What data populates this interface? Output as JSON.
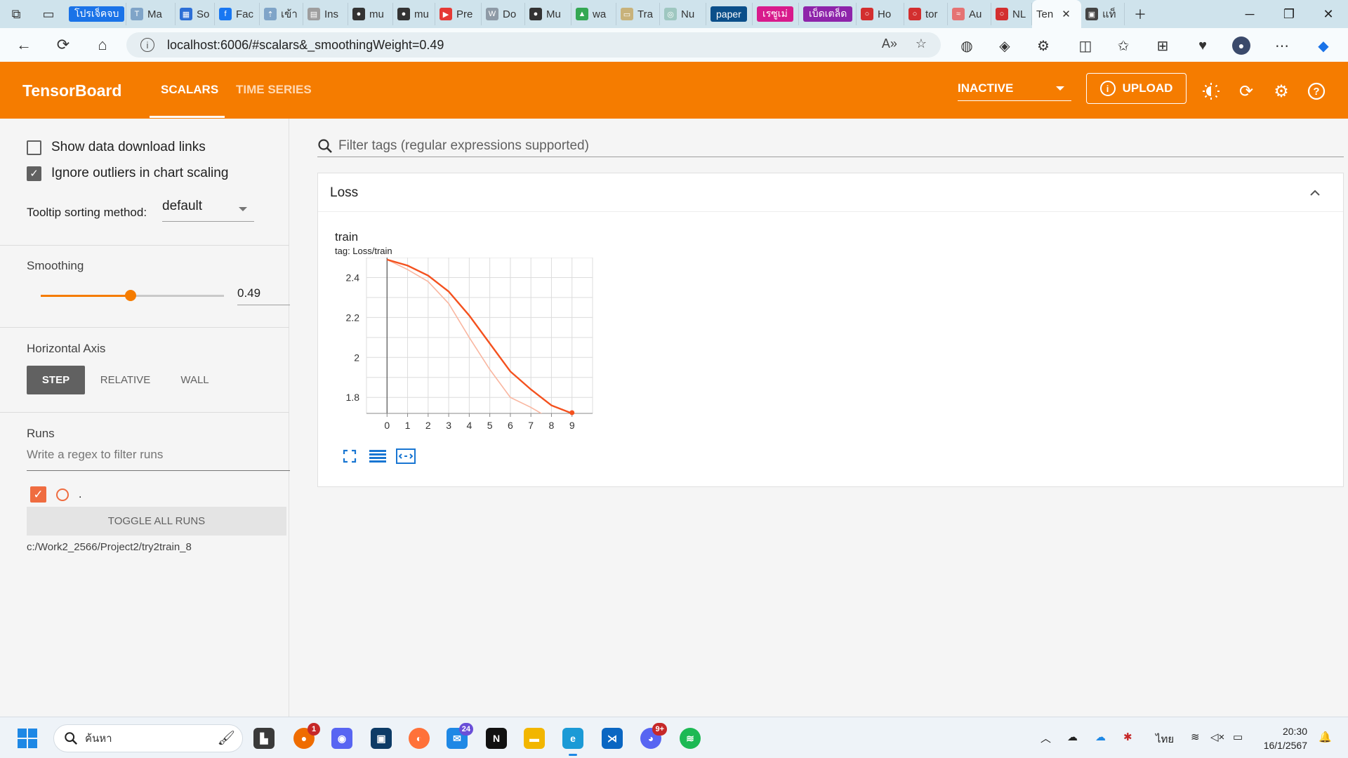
{
  "browser": {
    "tabs": [
      {
        "label": "",
        "chip": "โปรเจ็คจบ",
        "chip_color": "#1a73e8",
        "fav": "#1a73e8"
      },
      {
        "label": "Ma",
        "fav": "#7fa4c8",
        "glyph": "T"
      },
      {
        "label": "So",
        "fav": "#2d6fd6",
        "glyph": "▦"
      },
      {
        "label": "Fac",
        "fav": "#1877f2",
        "glyph": "f"
      },
      {
        "label": "เข้า",
        "fav": "#7fa4c8",
        "glyph": "⇡"
      },
      {
        "label": "Ins",
        "fav": "#9e9e9e",
        "glyph": "▤"
      },
      {
        "label": "mu",
        "fav": "#333333",
        "glyph": "●"
      },
      {
        "label": "mu",
        "fav": "#333333",
        "glyph": "●"
      },
      {
        "label": "Pre",
        "fav": "#e53935",
        "glyph": "▶"
      },
      {
        "label": "Do",
        "fav": "#8e9aa6",
        "glyph": "W"
      },
      {
        "label": "Mu",
        "fav": "#333333",
        "glyph": "●"
      },
      {
        "label": "wa",
        "fav": "#34a853",
        "glyph": "▲"
      },
      {
        "label": "Tra",
        "fav": "#c8b27a",
        "glyph": "▭"
      },
      {
        "label": "Nu",
        "fav": "#9ec7c0",
        "glyph": "◎"
      },
      {
        "label": "",
        "chip": "paper",
        "chip_color": "#0b4f8a"
      },
      {
        "label": "",
        "chip": "เรซูเม่",
        "chip_color": "#d81b8c"
      },
      {
        "label": "",
        "chip": "เบ็ดเตล็ด",
        "chip_color": "#8e24aa"
      },
      {
        "label": "Ho",
        "fav": "#d32f2f",
        "glyph": "○"
      },
      {
        "label": "tor",
        "fav": "#d32f2f",
        "glyph": "○"
      },
      {
        "label": "Au",
        "fav": "#e57373",
        "glyph": "≈"
      },
      {
        "label": "NL",
        "fav": "#d32f2f",
        "glyph": "○"
      },
      {
        "label": "Ten",
        "fav": "",
        "glyph": "",
        "active": true
      },
      {
        "label": "แท็",
        "fav": "#444444",
        "glyph": "▣"
      }
    ],
    "url": "localhost:6006/#scalars&_smoothingWeight=0.49",
    "icons": [
      "read-aloud-icon",
      "favorite-star-icon",
      "extensions-icon",
      "split-screen-icon",
      "favorites-icon",
      "collections-icon",
      "browser-essentials-icon",
      "profile-avatar-icon",
      "more-icon",
      "copilot-icon"
    ]
  },
  "header": {
    "logo": "TensorBoard",
    "tabs": [
      "SCALARS",
      "TIME SERIES"
    ],
    "active_tab": "SCALARS",
    "status": "INACTIVE",
    "upload": "UPLOAD",
    "accent": "#f57c00"
  },
  "sidebar": {
    "show_download_links": {
      "label": "Show data download links",
      "checked": false
    },
    "ignore_outliers": {
      "label": "Ignore outliers in chart scaling",
      "checked": true
    },
    "tooltip_label": "Tooltip sorting method:",
    "tooltip_value": "default",
    "smoothing_title": "Smoothing",
    "smoothing_value": "0.49",
    "smoothing_fraction": 0.49,
    "horizontal_axis_title": "Horizontal Axis",
    "axis_options": [
      "STEP",
      "RELATIVE",
      "WALL"
    ],
    "axis_selected": "STEP",
    "runs_title": "Runs",
    "runs_filter_placeholder": "Write a regex to filter runs",
    "run_name": ".",
    "run_color": "#ef6c40",
    "toggle_all": "TOGGLE ALL RUNS",
    "logdir": "c:/Work2_2566/Project2/try2train_8"
  },
  "main": {
    "filter_placeholder": "Filter tags (regular expressions supported)",
    "card_title": "Loss",
    "chart_title": "train",
    "chart_tag": "tag: Loss/train"
  },
  "chart_data": {
    "type": "line",
    "title": "train",
    "subtitle": "tag: Loss/train",
    "x": [
      0,
      1,
      2,
      3,
      4,
      5,
      6,
      7,
      8,
      9
    ],
    "series": [
      {
        "name": "smoothed",
        "values": [
          2.49,
          2.46,
          2.41,
          2.33,
          2.21,
          2.07,
          1.93,
          1.84,
          1.76,
          1.72
        ],
        "color": "#f4511e"
      },
      {
        "name": "raw",
        "values": [
          2.49,
          2.44,
          2.38,
          2.27,
          2.1,
          1.94,
          1.8,
          1.75,
          1.69,
          1.68
        ],
        "color": "#f9b6a0"
      }
    ],
    "xticks": [
      "0",
      "1",
      "2",
      "3",
      "4",
      "5",
      "6",
      "7",
      "8",
      "9"
    ],
    "yticks": [
      "1.8",
      "2",
      "2.2",
      "2.4"
    ],
    "xlim": [
      -1,
      10
    ],
    "ylim": [
      1.72,
      2.5
    ],
    "grid": true
  },
  "taskbar": {
    "search_placeholder": "ค้นหา",
    "apps": [
      {
        "name": "file-explorer-icon",
        "badge": ""
      },
      {
        "name": "app-orange-icon",
        "badge": "1"
      },
      {
        "name": "discord-alt-icon",
        "badge": ""
      },
      {
        "name": "code-dark-icon",
        "badge": ""
      },
      {
        "name": "firefox-icon",
        "badge": ""
      },
      {
        "name": "mail-icon",
        "badge": "24"
      },
      {
        "name": "notion-icon",
        "badge": ""
      },
      {
        "name": "folder-icon",
        "badge": ""
      },
      {
        "name": "edge-icon",
        "badge": ""
      },
      {
        "name": "vscode-icon",
        "badge": ""
      },
      {
        "name": "discord-icon",
        "badge": "9+"
      },
      {
        "name": "spotify-icon",
        "badge": ""
      }
    ],
    "language": "ไทย",
    "time": "20:30",
    "date": "16/1/2567"
  }
}
